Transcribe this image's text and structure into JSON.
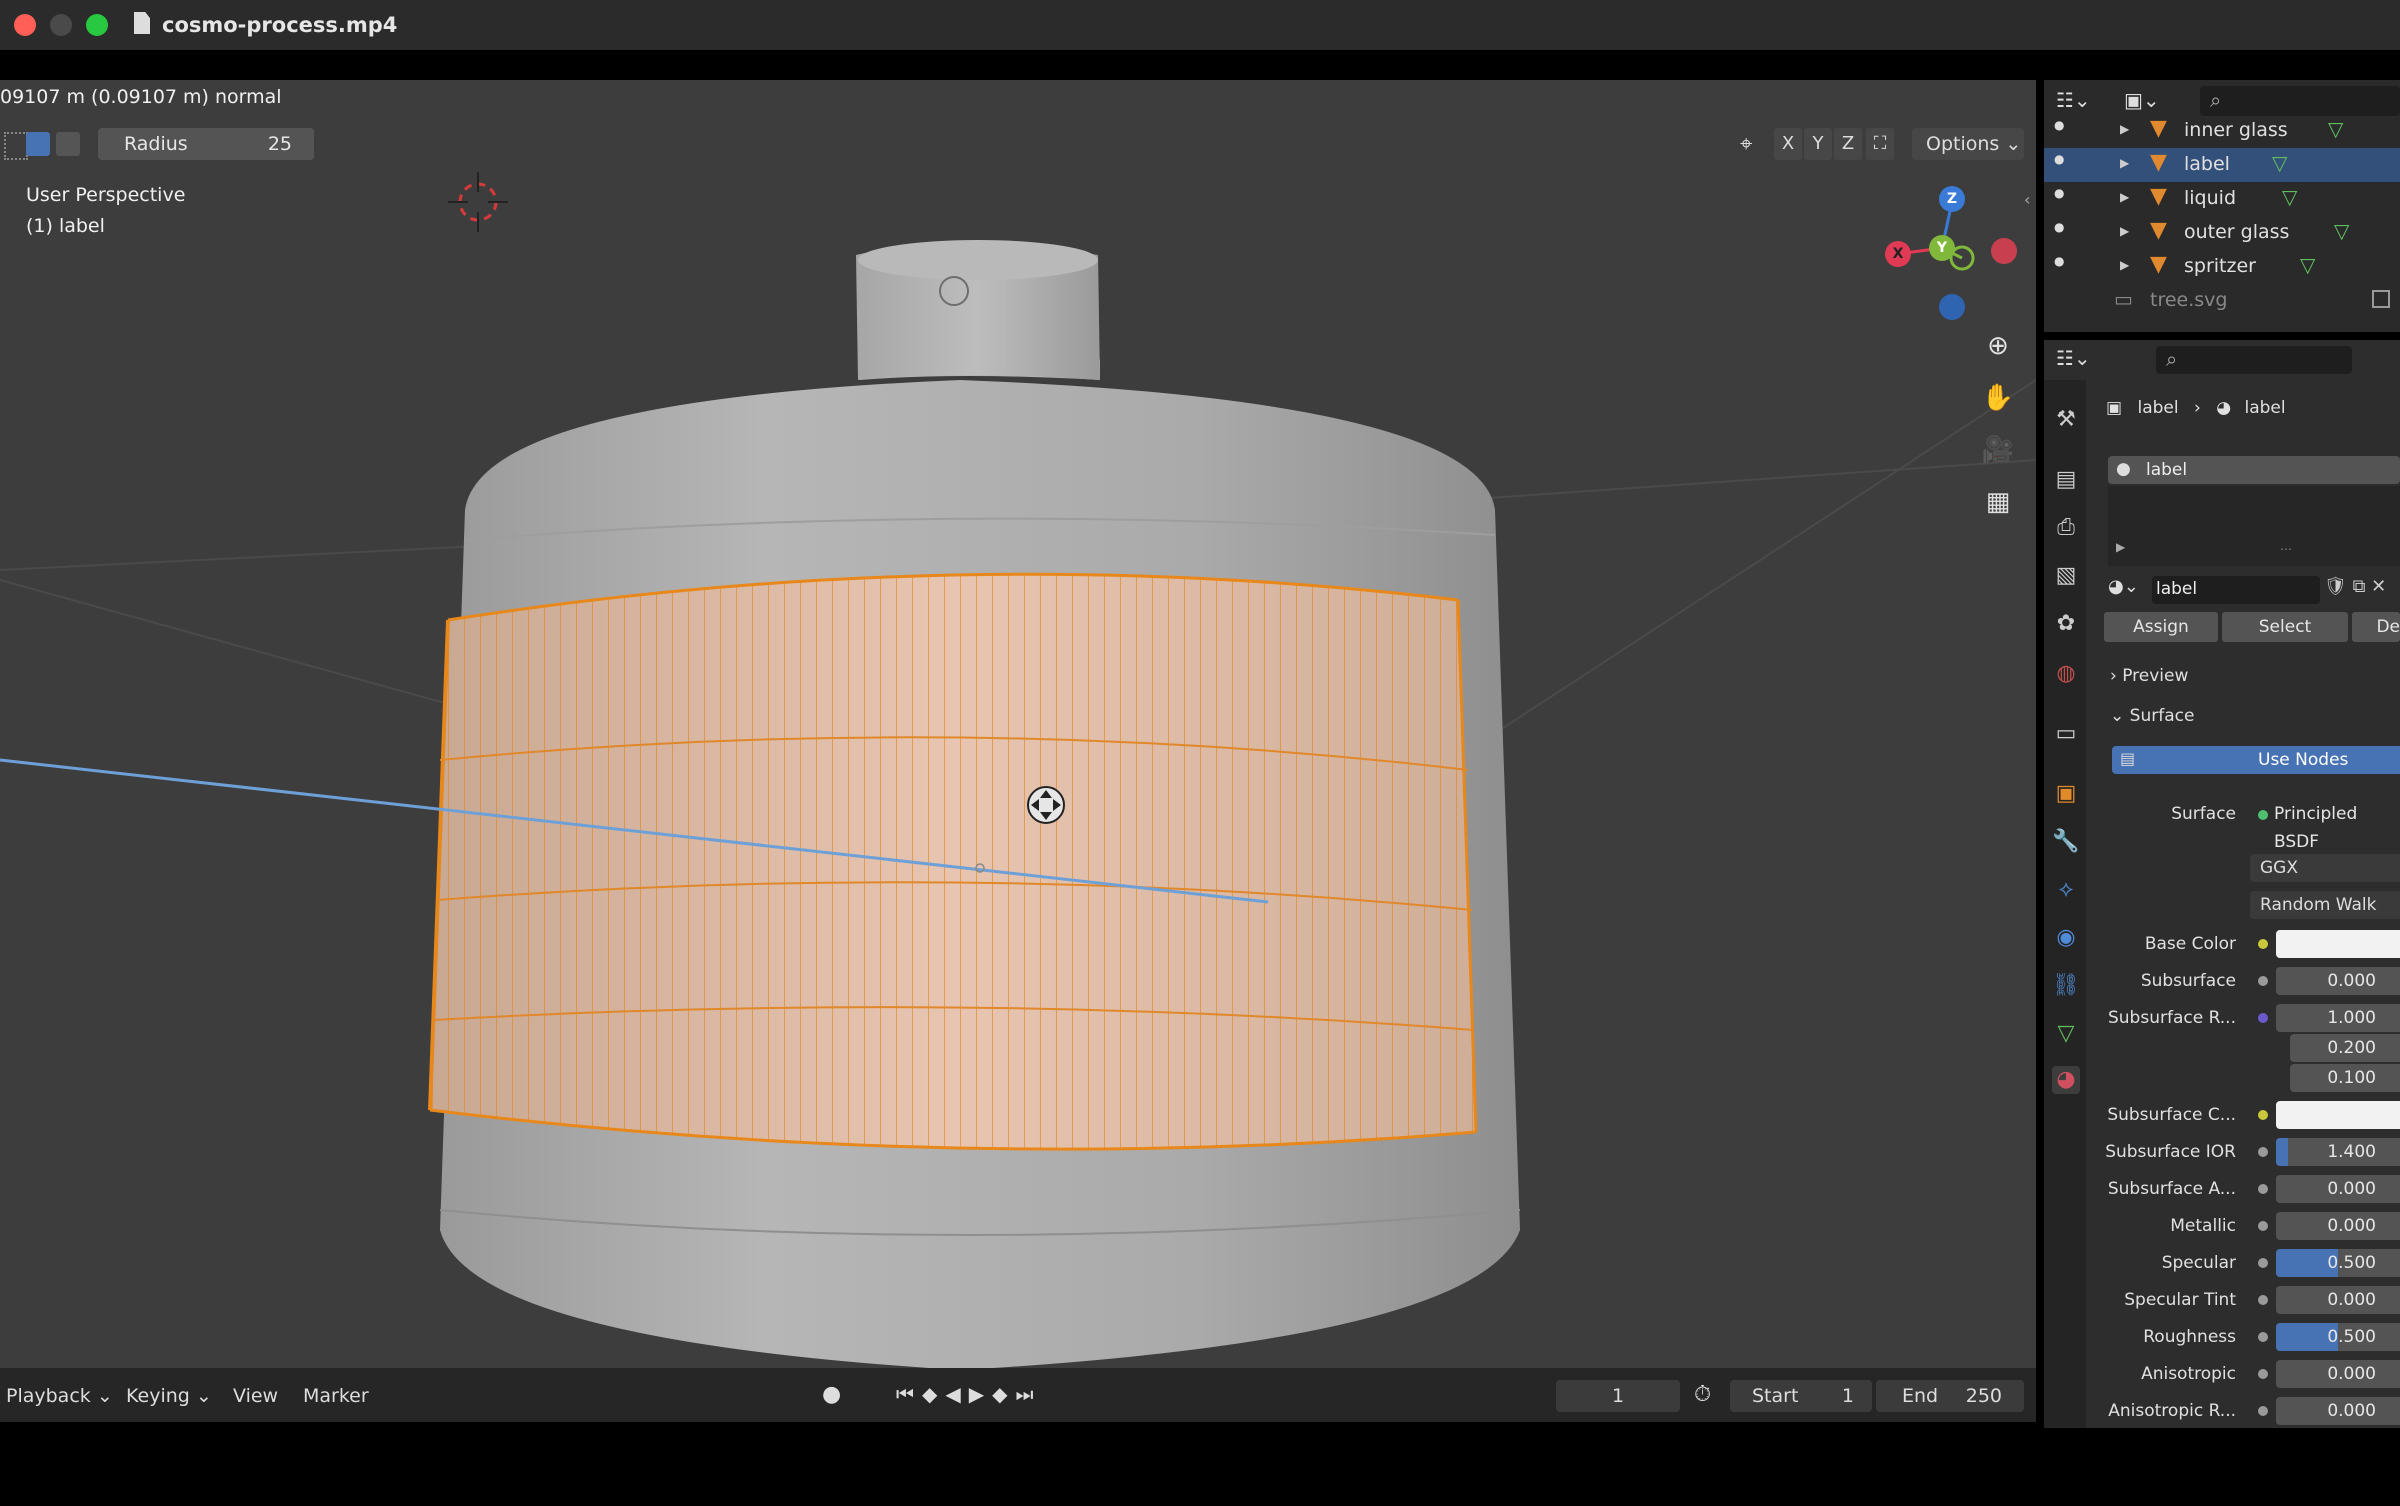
{
  "window": {
    "title": "cosmo-process.mp4"
  },
  "viewport": {
    "header_text": "09107 m (0.09107 m) normal",
    "radius_label": "Radius",
    "radius_value": "25",
    "perspective": "User Perspective",
    "active_object": "(1) label",
    "axis_x": "X",
    "axis_y": "Y",
    "axis_z": "Z",
    "options_label": "Options",
    "gizmo": {
      "x": "X",
      "y": "Y",
      "z": "Z"
    },
    "colors": {
      "mesh": "#a9a9a9",
      "selection": "#f08a10",
      "background": "#3d3d3d"
    }
  },
  "timeline": {
    "menus": [
      "Playback",
      "Keying",
      "View",
      "Marker"
    ],
    "current_frame": "1",
    "start_label": "Start",
    "start_value": "1",
    "end_label": "End",
    "end_value": "250"
  },
  "outliner": {
    "items": [
      {
        "name": "inner glass",
        "selected": false
      },
      {
        "name": "label",
        "selected": true
      },
      {
        "name": "liquid",
        "selected": false
      },
      {
        "name": "outer glass",
        "selected": false
      },
      {
        "name": "spritzer",
        "selected": false
      },
      {
        "name": "tree.svg",
        "selected": false
      }
    ]
  },
  "properties": {
    "breadcrumb_object": "label",
    "breadcrumb_material": "label",
    "slot_name": "label",
    "material_name": "label",
    "assign_label": "Assign",
    "select_label": "Select",
    "deselect_label": "De",
    "preview_label": "Preview",
    "surface_panel_label": "Surface",
    "use_nodes_label": "Use Nodes",
    "surface_label": "Surface",
    "surface_value": "Principled BSDF",
    "distribution": "GGX",
    "subsurface_method": "Random Walk",
    "rows": [
      {
        "label": "Base Color",
        "value": "",
        "fill": 0
      },
      {
        "label": "Subsurface",
        "value": "0.000",
        "fill": 0
      },
      {
        "label": "Subsurface R...",
        "value": "1.000",
        "fill": 0
      },
      {
        "label": "",
        "value": "0.200",
        "fill": 0
      },
      {
        "label": "",
        "value": "0.100",
        "fill": 0
      },
      {
        "label": "Subsurface C...",
        "value": "",
        "fill": 0
      },
      {
        "label": "Subsurface IOR",
        "value": "1.400",
        "fill": 0.1
      },
      {
        "label": "Subsurface A...",
        "value": "0.000",
        "fill": 0
      },
      {
        "label": "Metallic",
        "value": "0.000",
        "fill": 0
      },
      {
        "label": "Specular",
        "value": "0.500",
        "fill": 0.5
      },
      {
        "label": "Specular Tint",
        "value": "0.000",
        "fill": 0
      },
      {
        "label": "Roughness",
        "value": "0.500",
        "fill": 0.5
      },
      {
        "label": "Anisotropic",
        "value": "0.000",
        "fill": 0
      },
      {
        "label": "Anisotropic R...",
        "value": "0.000",
        "fill": 0
      }
    ]
  }
}
